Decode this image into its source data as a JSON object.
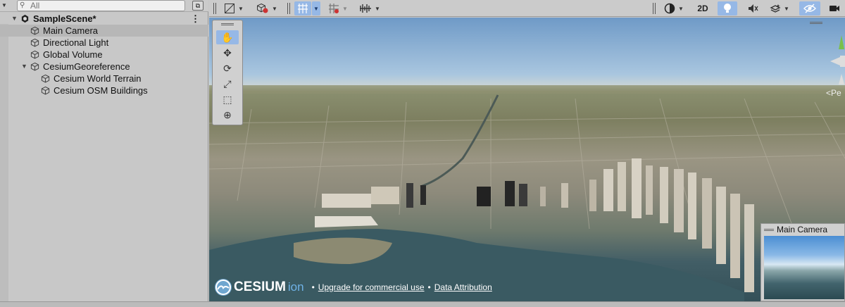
{
  "hierarchy": {
    "search": {
      "placeholder": "All"
    },
    "scene": {
      "name": "SampleScene*"
    },
    "items": [
      {
        "label": "Main Camera"
      },
      {
        "label": "Directional Light"
      },
      {
        "label": "Global Volume"
      },
      {
        "label": "CesiumGeoreference"
      },
      {
        "label": "Cesium World Terrain"
      },
      {
        "label": "Cesium OSM Buildings"
      }
    ]
  },
  "scene_toolbar": {
    "mode_2d": "2D"
  },
  "viewport": {
    "persp_label": "<Pe",
    "credits": {
      "brand": "CESIUM",
      "brand_suffix": "ion",
      "upgrade_link": "Upgrade for commercial use",
      "attribution_link": "Data Attribution",
      "bullet": "•"
    },
    "camera_preview": {
      "title": "Main Camera"
    }
  },
  "colors": {
    "selection": "#b7b7b7",
    "active_tool": "#96b8e6",
    "ion_blue": "#6fb2e6"
  }
}
